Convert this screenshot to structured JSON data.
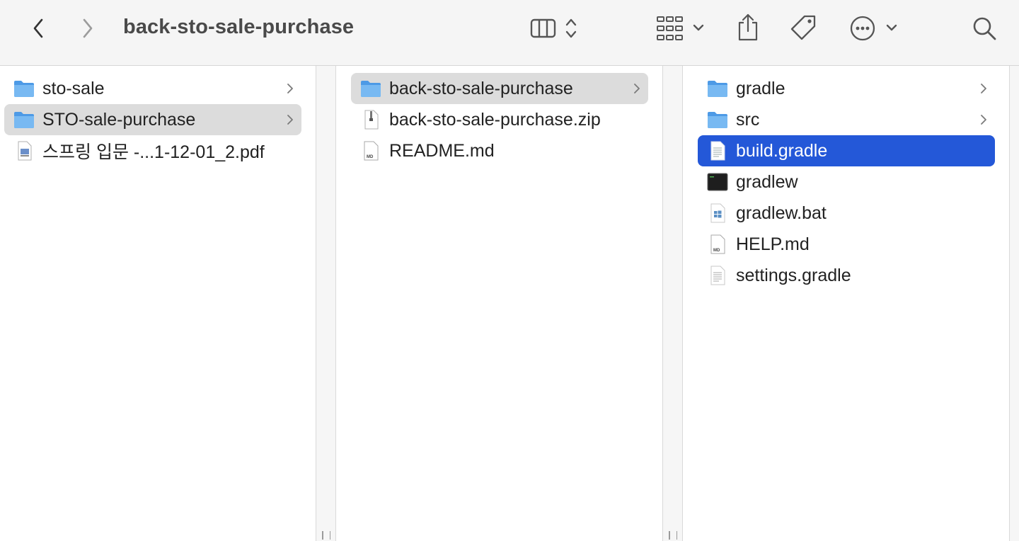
{
  "window": {
    "title": "back-sto-sale-purchase"
  },
  "toolbar": {
    "back_icon": "chevron-left-icon",
    "forward_icon": "chevron-right-icon",
    "view_icon": "columns-view-icon",
    "group_icon": "grid-group-icon",
    "share_icon": "share-icon",
    "tag_icon": "tag-icon",
    "more_icon": "ellipsis-circle-icon",
    "search_icon": "search-icon"
  },
  "columns": [
    {
      "items": [
        {
          "label": "sto-sale",
          "type": "folder",
          "has_children": true,
          "selected": false
        },
        {
          "label": "STO-sale-purchase",
          "type": "folder",
          "has_children": true,
          "selected": "inactive"
        },
        {
          "label": "스프링 입문 -...1-12-01_2.pdf",
          "type": "pdf",
          "has_children": false,
          "selected": false
        }
      ]
    },
    {
      "items": [
        {
          "label": "back-sto-sale-purchase",
          "type": "folder",
          "has_children": true,
          "selected": "inactive"
        },
        {
          "label": "back-sto-sale-purchase.zip",
          "type": "zip",
          "has_children": false,
          "selected": false
        },
        {
          "label": "README.md",
          "type": "md",
          "has_children": false,
          "selected": false
        }
      ]
    },
    {
      "items": [
        {
          "label": "gradle",
          "type": "folder",
          "has_children": true,
          "selected": false
        },
        {
          "label": "src",
          "type": "folder",
          "has_children": true,
          "selected": false
        },
        {
          "label": "build.gradle",
          "type": "text",
          "has_children": false,
          "selected": "active"
        },
        {
          "label": "gradlew",
          "type": "exec",
          "has_children": false,
          "selected": false
        },
        {
          "label": "gradlew.bat",
          "type": "bat",
          "has_children": false,
          "selected": false
        },
        {
          "label": "HELP.md",
          "type": "md",
          "has_children": false,
          "selected": false
        },
        {
          "label": "settings.gradle",
          "type": "text",
          "has_children": false,
          "selected": false
        }
      ]
    }
  ],
  "icon_text": {
    "md_badge": "MD"
  },
  "colors": {
    "selection_active": "#2458d8",
    "selection_inactive": "#dcdcdc",
    "folder": "#5aa9f0"
  }
}
